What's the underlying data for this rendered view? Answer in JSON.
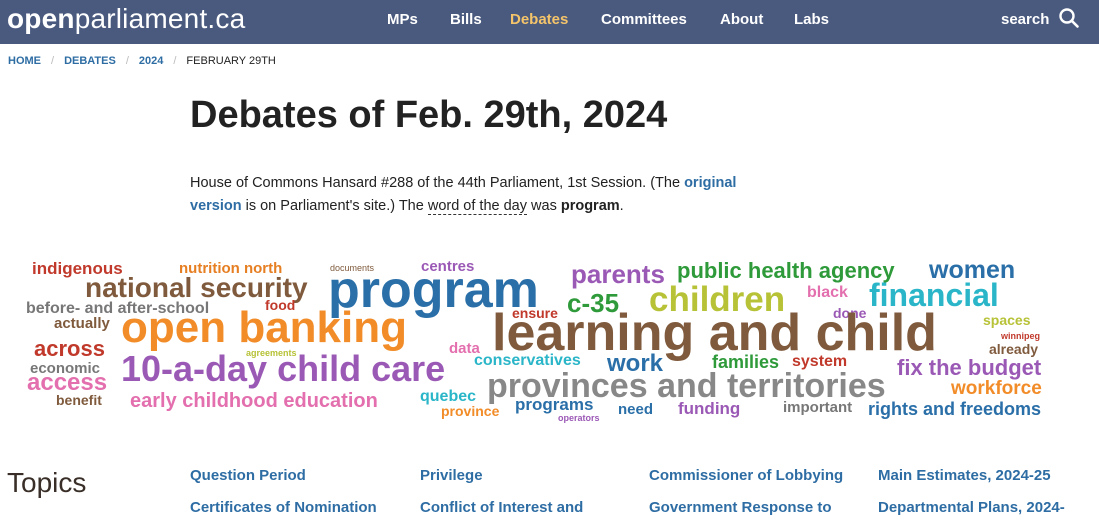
{
  "site": {
    "logo_bold": "open",
    "logo_rest": "parliament.ca"
  },
  "nav": {
    "items": [
      "MPs",
      "Bills",
      "Debates",
      "Committees",
      "About",
      "Labs"
    ],
    "active": "Debates",
    "search_label": "search"
  },
  "breadcrumb": [
    "HOME",
    "DEBATES",
    "2024",
    "FEBRUARY 29TH"
  ],
  "page": {
    "title": "Debates of Feb. 29th, 2024",
    "intro_1": "House of Commons Hansard #288 of the 44th Parliament, 1st Session. (The ",
    "intro_link_1": "original",
    "intro_link_2": "version",
    "intro_2": " is on Parliament's site.) The ",
    "intro_word": "word of the day",
    "intro_3": " was ",
    "intro_program": "program",
    "intro_4": "."
  },
  "word_cloud": [
    {
      "text": "indigenous",
      "color": "#c0392b"
    },
    {
      "text": "nutrition north",
      "color": "#e67e22"
    },
    {
      "text": "documents",
      "color": "#7f5a3c"
    },
    {
      "text": "centres",
      "color": "#9b59b6"
    },
    {
      "text": "parents",
      "color": "#9b59b6"
    },
    {
      "text": "public health agency",
      "color": "#2e9a3a"
    },
    {
      "text": "women",
      "color": "#2a6fa8"
    },
    {
      "text": "national security",
      "color": "#7f5a3c"
    },
    {
      "text": "program",
      "color": "#2a6fa8"
    },
    {
      "text": "c-35",
      "color": "#2e9a3a"
    },
    {
      "text": "children",
      "color": "#b7c236"
    },
    {
      "text": "black",
      "color": "#e36fae"
    },
    {
      "text": "financial",
      "color": "#2ab6c8"
    },
    {
      "text": "before- and after-school",
      "color": "#777777"
    },
    {
      "text": "food",
      "color": "#c0392b"
    },
    {
      "text": "ensure",
      "color": "#c0392b"
    },
    {
      "text": "done",
      "color": "#9b59b6"
    },
    {
      "text": "spaces",
      "color": "#b7c236"
    },
    {
      "text": "actually",
      "color": "#7f5a3c"
    },
    {
      "text": "open banking",
      "color": "#f28c28"
    },
    {
      "text": "learning and child",
      "color": "#7f5a3c"
    },
    {
      "text": "winnipeg",
      "color": "#c0392b"
    },
    {
      "text": "across",
      "color": "#c0392b"
    },
    {
      "text": "already",
      "color": "#7f5a3c"
    },
    {
      "text": "agreements",
      "color": "#b7c236"
    },
    {
      "text": "data",
      "color": "#e36fae"
    },
    {
      "text": "conservatives",
      "color": "#2ab6c8"
    },
    {
      "text": "families",
      "color": "#2e9a3a"
    },
    {
      "text": "system",
      "color": "#c0392b"
    },
    {
      "text": "economic",
      "color": "#777777"
    },
    {
      "text": "10-a-day child care",
      "color": "#9b59b6"
    },
    {
      "text": "work",
      "color": "#2a6fa8"
    },
    {
      "text": "fix the budget",
      "color": "#9b59b6"
    },
    {
      "text": "access",
      "color": "#e36fae"
    },
    {
      "text": "provinces and territories",
      "color": "#888888"
    },
    {
      "text": "workforce",
      "color": "#f28c28"
    },
    {
      "text": "benefit",
      "color": "#7f5a3c"
    },
    {
      "text": "quebec",
      "color": "#2ab6c8"
    },
    {
      "text": "early childhood education",
      "color": "#e36fae"
    },
    {
      "text": "programs",
      "color": "#2a6fa8"
    },
    {
      "text": "need",
      "color": "#2a6fa8"
    },
    {
      "text": "funding",
      "color": "#9b59b6"
    },
    {
      "text": "important",
      "color": "#777777"
    },
    {
      "text": "rights and freedoms",
      "color": "#2a6fa8"
    },
    {
      "text": "province",
      "color": "#f28c28"
    },
    {
      "text": "operators",
      "color": "#9b59b6"
    }
  ],
  "topics": {
    "title": "Topics",
    "items": [
      "Question Period",
      "Privilege",
      "Commissioner of Lobbying",
      "Main Estimates, 2024-25",
      "Certificates of Nomination",
      "Conflict of Interest and",
      "Government Response to",
      "Departmental Plans, 2024-"
    ]
  }
}
